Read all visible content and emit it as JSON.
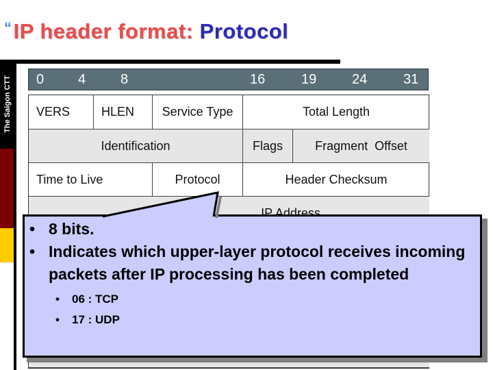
{
  "title": {
    "quote_glyph": "“",
    "part1": "IP header format: ",
    "part2": "Protocol"
  },
  "sidebar": {
    "label": "The Saigon CTT"
  },
  "bit_positions": [
    "0",
    "4",
    "8",
    "16",
    "19",
    "24",
    "31"
  ],
  "header_rows": [
    [
      "VERS",
      "HLEN",
      "Service Type",
      "Total Length"
    ],
    [
      "Identification",
      "Flags",
      "Fragment  Offset"
    ],
    [
      "Time to Live",
      "Protocol",
      "Header Checksum"
    ],
    [
      "IP Address"
    ]
  ],
  "callout": {
    "points": [
      "8 bits.",
      "Indicates which upper-layer protocol receives incoming packets after IP processing has been completed"
    ],
    "subpoints": [
      "06 : TCP",
      "17 : UDP"
    ]
  },
  "colors": {
    "title_red": "#ee4a4a",
    "title_blue": "#2b2bb8",
    "callout_fill": "#ccccff",
    "bitbar_fill": "#5a6f78",
    "side_maroon": "#7a0000",
    "side_yellow": "#ffcc00"
  }
}
